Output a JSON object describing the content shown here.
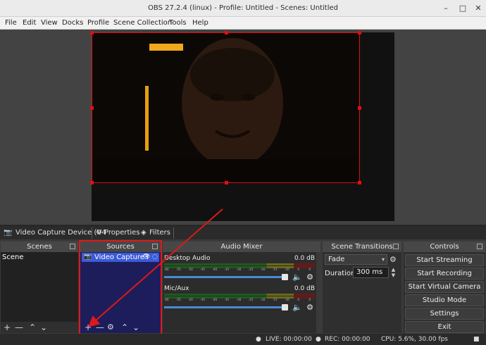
{
  "window": {
    "title": "OBS 27.2.4 (linux) - Profile: Untitled - Scenes: Untitled",
    "minimize": "–",
    "maximize": "□",
    "close": "✕"
  },
  "menu": [
    "File",
    "Edit",
    "View",
    "Docks",
    "Profile",
    "Scene Collection",
    "Tools",
    "Help"
  ],
  "source_toolbar": {
    "source_name": "Video Capture Device (V4",
    "properties": "Properties",
    "filters": "Filters"
  },
  "scenes": {
    "title": "Scenes",
    "items": [
      "Scene"
    ]
  },
  "sources": {
    "title": "Sources",
    "items": [
      {
        "name": "Video Capture I"
      }
    ]
  },
  "mixer": {
    "title": "Audio Mixer",
    "channels": [
      {
        "name": "Desktop Audio",
        "db": "0.0 dB"
      },
      {
        "name": "Mic/Aux",
        "db": "0.0 dB"
      }
    ],
    "ticks": [
      "-60",
      "-55",
      "-50",
      "-45",
      "-40",
      "-35",
      "-30",
      "-25",
      "-20",
      "-15",
      "-10",
      "-5",
      "0"
    ]
  },
  "transitions": {
    "title": "Scene Transitions",
    "selected": "Fade",
    "duration_label": "Duration",
    "duration_value": "300 ms"
  },
  "controls": {
    "title": "Controls",
    "buttons": [
      "Start Streaming",
      "Start Recording",
      "Start Virtual Camera",
      "Studio Mode",
      "Settings",
      "Exit"
    ]
  },
  "status": {
    "live": "LIVE: 00:00:00",
    "rec": "REC: 00:00:00",
    "cpu": "CPU: 5.6%, 30.00 fps"
  },
  "colors": {
    "selection": "#e01010",
    "source_selected": "#3b5bd6",
    "sources_list_bg": "#1d1d5c"
  }
}
